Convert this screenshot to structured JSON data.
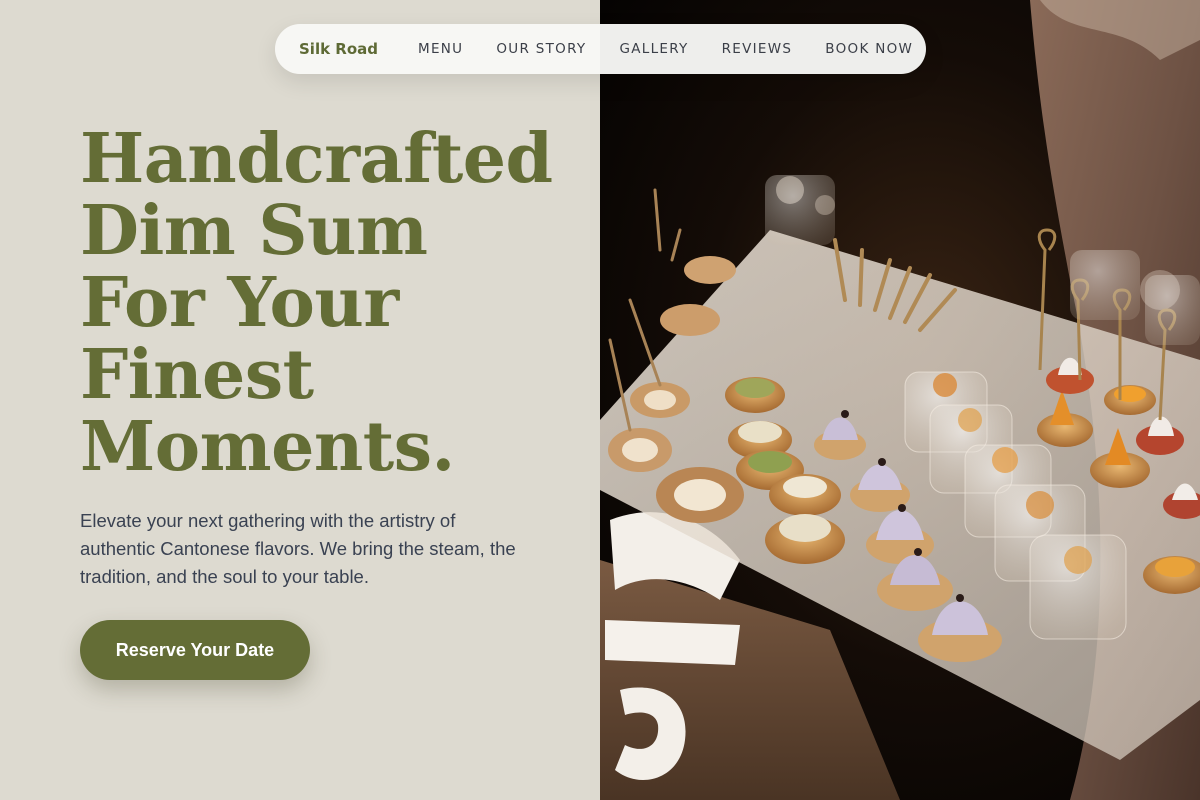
{
  "nav": {
    "brand": "Silk Road",
    "links": [
      "MENU",
      "OUR STORY",
      "GALLERY",
      "REVIEWS",
      "BOOK NOW"
    ]
  },
  "hero": {
    "title_lines": [
      "Handcrafted",
      "Dim Sum",
      "For Your",
      "Finest",
      "Moments."
    ],
    "subtitle": "Elevate your next gathering with the artistry of authentic Cantonese flavors. We bring the steam, the tradition, and the soul to your table.",
    "cta_label": "Reserve Your Date"
  },
  "colors": {
    "accent": "#646d36",
    "background": "#dddad0",
    "nav_background": "#f8f8f6",
    "body_text": "#3a4252"
  },
  "image": {
    "semantic": "catering-platter-photo"
  }
}
